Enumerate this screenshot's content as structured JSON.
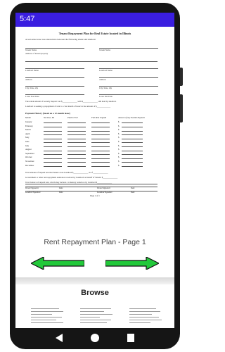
{
  "status_bar": {
    "time": "5:47",
    "color": "#3a1ee0"
  },
  "document": {
    "title": "Tenant Repayment Plan for Real Estate located in Illinois",
    "intro": "A real estate lease was entered into between the following tenant and landlord:",
    "tenant_name_labels": [
      "Tenant Name",
      "Tenant Name"
    ],
    "premises_label": "Address of leased property",
    "landlord_labels": [
      "Landlord Name",
      "Landlord Name"
    ],
    "address_labels": [
      "Address",
      "Address"
    ],
    "city_labels": [
      "City, State, Zip",
      "City, State, Zip"
    ],
    "date_labels": [
      "Lease Start Date",
      "Lease End Date"
    ],
    "rent_sentence": "The rental amount of security deposit was $______________ with $______________ still held by landlord.",
    "shortfall_sentence": "Landlord is seeking a prepayment of rent to a 'last month of lease' in the amount of $_____________",
    "history_title": "Payment History (based on a 12-month lease)",
    "history_headers": [
      "Month",
      "Not Due, Yet",
      "Paid in Full",
      "Full Rent Unpaid",
      "Amount of any Partial Payment"
    ],
    "months": [
      "January",
      "February",
      "March",
      "April",
      "May",
      "June",
      "July",
      "August",
      "September",
      "October",
      "November",
      "December"
    ],
    "dollar_sign": "$",
    "total_unpaid": "Total amount of unpaid rent that Tenant owes Landlord $______________ as of ______________",
    "government_note": "Government or other rent repayment assistance received by Landlord on behalf of Tenant: $______________",
    "balance_note": "Total balance of unpaid rent, which may include a voluntary reduction by Landlord $______________",
    "signature_labels": [
      "Tenant Signature",
      "Date",
      "Tenant Signature",
      "Date",
      "Landlord Signature",
      "Date",
      "Landlord Signature",
      "Date"
    ],
    "page_indicator": "Page 1 of 1"
  },
  "caption": "Rent Repayment Plan - Page 1",
  "arrows": {
    "previous": "previous-page",
    "next": "next-page",
    "color": "#22c93a"
  },
  "browse_title": "Browse",
  "icons": [
    "camera-icon",
    "back-icon",
    "home-icon",
    "recents-icon"
  ]
}
